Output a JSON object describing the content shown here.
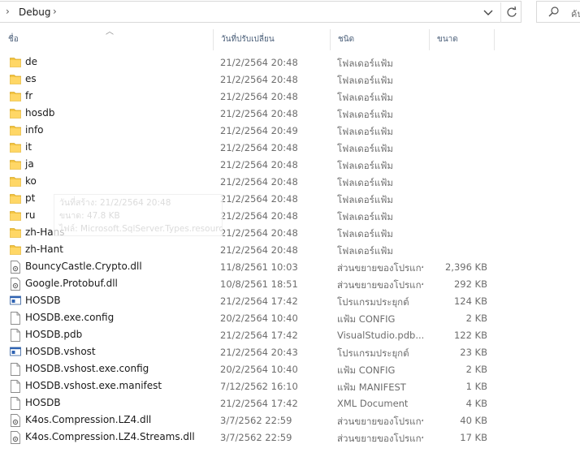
{
  "address": {
    "path": "Debug",
    "chevron_left": "›",
    "chevron_right": "›"
  },
  "search": {
    "placeholder": "ค้น"
  },
  "columns": {
    "name": "ชื่อ",
    "date": "วันที่ปรับเปลี่ยน",
    "type": "ชนิด",
    "size": "ขนาด"
  },
  "tooltip": {
    "line1": "วันที่สร้าง: 21/2/2564 20:48",
    "line2": "ขนาด: 47.8 KB",
    "line3": "ไฟล์: Microsoft.SqlServer.Types.resources.dll"
  },
  "files": [
    {
      "name": "de",
      "date": "21/2/2564 20:48",
      "type": "โฟลเดอร์แฟ้ม",
      "size": "",
      "icon": "folder"
    },
    {
      "name": "es",
      "date": "21/2/2564 20:48",
      "type": "โฟลเดอร์แฟ้ม",
      "size": "",
      "icon": "folder"
    },
    {
      "name": "fr",
      "date": "21/2/2564 20:48",
      "type": "โฟลเดอร์แฟ้ม",
      "size": "",
      "icon": "folder"
    },
    {
      "name": "hosdb",
      "date": "21/2/2564 20:48",
      "type": "โฟลเดอร์แฟ้ม",
      "size": "",
      "icon": "folder"
    },
    {
      "name": "info",
      "date": "21/2/2564 20:49",
      "type": "โฟลเดอร์แฟ้ม",
      "size": "",
      "icon": "folder"
    },
    {
      "name": "it",
      "date": "21/2/2564 20:48",
      "type": "โฟลเดอร์แฟ้ม",
      "size": "",
      "icon": "folder"
    },
    {
      "name": "ja",
      "date": "21/2/2564 20:48",
      "type": "โฟลเดอร์แฟ้ม",
      "size": "",
      "icon": "folder"
    },
    {
      "name": "ko",
      "date": "21/2/2564 20:48",
      "type": "โฟลเดอร์แฟ้ม",
      "size": "",
      "icon": "folder"
    },
    {
      "name": "pt",
      "date": "21/2/2564 20:48",
      "type": "โฟลเดอร์แฟ้ม",
      "size": "",
      "icon": "folder"
    },
    {
      "name": "ru",
      "date": "21/2/2564 20:48",
      "type": "โฟลเดอร์แฟ้ม",
      "size": "",
      "icon": "folder"
    },
    {
      "name": "zh-Hans",
      "date": "21/2/2564 20:48",
      "type": "โฟลเดอร์แฟ้ม",
      "size": "",
      "icon": "folder"
    },
    {
      "name": "zh-Hant",
      "date": "21/2/2564 20:48",
      "type": "โฟลเดอร์แฟ้ม",
      "size": "",
      "icon": "folder"
    },
    {
      "name": "BouncyCastle.Crypto.dll",
      "date": "11/8/2561 10:03",
      "type": "ส่วนขยายของโปรแกร...",
      "size": "2,396 KB",
      "icon": "dll"
    },
    {
      "name": "Google.Protobuf.dll",
      "date": "10/8/2561 18:51",
      "type": "ส่วนขยายของโปรแกร...",
      "size": "292 KB",
      "icon": "dll"
    },
    {
      "name": "HOSDB",
      "date": "21/2/2564 17:42",
      "type": "โปรแกรมประยุกต์",
      "size": "124 KB",
      "icon": "exe"
    },
    {
      "name": "HOSDB.exe.config",
      "date": "20/2/2564 10:40",
      "type": "แฟ้ม CONFIG",
      "size": "2 KB",
      "icon": "file"
    },
    {
      "name": "HOSDB.pdb",
      "date": "21/2/2564 17:42",
      "type": "VisualStudio.pdb....",
      "size": "122 KB",
      "icon": "file"
    },
    {
      "name": "HOSDB.vshost",
      "date": "21/2/2564 20:43",
      "type": "โปรแกรมประยุกต์",
      "size": "23 KB",
      "icon": "exe"
    },
    {
      "name": "HOSDB.vshost.exe.config",
      "date": "20/2/2564 10:40",
      "type": "แฟ้ม CONFIG",
      "size": "2 KB",
      "icon": "file"
    },
    {
      "name": "HOSDB.vshost.exe.manifest",
      "date": "7/12/2562 16:10",
      "type": "แฟ้ม MANIFEST",
      "size": "1 KB",
      "icon": "file"
    },
    {
      "name": "HOSDB",
      "date": "21/2/2564 17:42",
      "type": "XML Document",
      "size": "4 KB",
      "icon": "file"
    },
    {
      "name": "K4os.Compression.LZ4.dll",
      "date": "3/7/2562 22:59",
      "type": "ส่วนขยายของโปรแกร...",
      "size": "40 KB",
      "icon": "dll"
    },
    {
      "name": "K4os.Compression.LZ4.Streams.dll",
      "date": "3/7/2562 22:59",
      "type": "ส่วนขยายของโปรแกร...",
      "size": "17 KB",
      "icon": "dll"
    }
  ]
}
